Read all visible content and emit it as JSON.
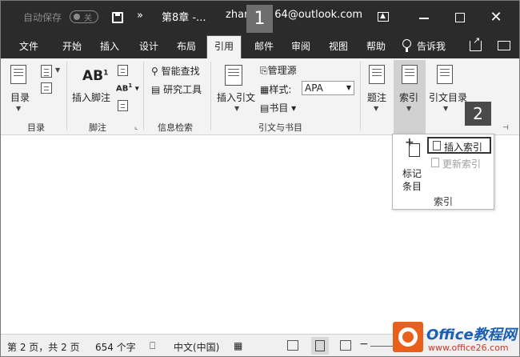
{
  "titlebar": {
    "autosave_label": "自动保存",
    "autosave_state": "关",
    "more": "»",
    "doc_title": "第8章 -...",
    "user_email": "zhan",
    "user_email_tail": "64@outlook.com",
    "callout_1": "1",
    "minimize": "−",
    "close": "✕"
  },
  "tabs": [
    "文件",
    "开始",
    "插入",
    "设计",
    "布局",
    "引用",
    "邮件",
    "审阅",
    "视图",
    "帮助",
    "告诉我"
  ],
  "ribbon": {
    "toc": {
      "button": "目录",
      "group": "目录"
    },
    "footnotes": {
      "insert_footnote": "插入脚注",
      "ab_label": "AB",
      "ab_sup": "1",
      "ab_small": "AB",
      "group": "脚注"
    },
    "research": {
      "smart_lookup": "智能查找",
      "researcher": "研究工具",
      "group": "信息检索"
    },
    "citations": {
      "insert_citation": "插入引文",
      "manage_sources": "管理源",
      "style_label": "样式:",
      "style_value": "APA",
      "bibliography": "书目",
      "group": "引文与书目"
    },
    "captions": {
      "insert_caption": "题注"
    },
    "index": {
      "button": "索引"
    },
    "toa": {
      "button": "引文目录"
    },
    "callout_2": "2"
  },
  "index_dropdown": {
    "mark_entry": "标记\n条目",
    "mark_entry_line1": "标记",
    "mark_entry_line2": "条目",
    "insert_index": "插入索引",
    "update_index": "更新索引",
    "group_label": "索引"
  },
  "statusbar": {
    "page": "第 2 页，共 2 页",
    "words": "654 个字",
    "language": "中文(中国)"
  },
  "watermark": {
    "title": "Office教程网",
    "url": "www.office26.com"
  },
  "colors": {
    "titlebar_bg": "#2b2b2b",
    "ribbon_bg": "#f3f3f3",
    "selected_button_bg": "#d1d1d1"
  }
}
